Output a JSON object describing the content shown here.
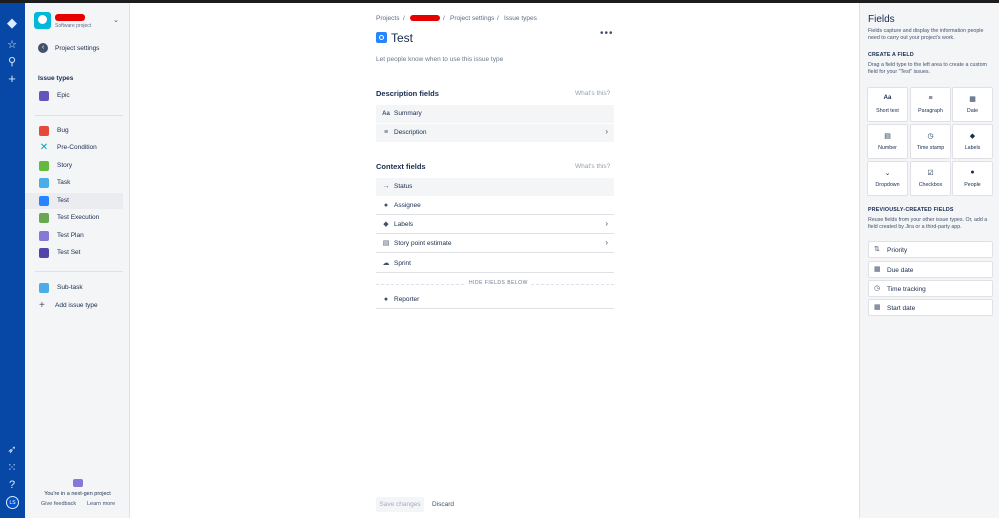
{
  "global_nav": {
    "avatar_initials": "LS"
  },
  "project": {
    "type": "Software project"
  },
  "sidebar": {
    "back_label": "Project settings",
    "section_title": "Issue types",
    "items": [
      {
        "label": "Epic",
        "color": "#6554C0"
      },
      {
        "label": "Bug",
        "color": "#E5493A"
      },
      {
        "label": "Pre-Condition",
        "color": "#00A3BF"
      },
      {
        "label": "Story",
        "color": "#63BA3C"
      },
      {
        "label": "Task",
        "color": "#4BADE8"
      },
      {
        "label": "Test",
        "color": "#2684FF"
      },
      {
        "label": "Test Execution",
        "color": "#6AA84F"
      },
      {
        "label": "Test Plan",
        "color": "#8777D9"
      },
      {
        "label": "Test Set",
        "color": "#5243AA"
      },
      {
        "label": "Sub-task",
        "color": "#4BADE8"
      }
    ],
    "add_label": "Add issue type",
    "next_gen_text": "You're in a next-gen project",
    "give_feedback": "Give feedback",
    "learn_more": "Learn more"
  },
  "main": {
    "breadcrumb": {
      "projects": "Projects",
      "project_settings": "Project settings",
      "issue_types": "Issue types",
      "sep": "/"
    },
    "title": "Test",
    "more": "•••",
    "description_placeholder": "Let people know when to use this issue type",
    "description_fields_title": "Description fields",
    "whats_this": "What's this?",
    "description_fields": [
      {
        "label": "Summary",
        "icon": "Aa"
      },
      {
        "label": "Description",
        "icon": "≡"
      }
    ],
    "context_fields_title": "Context fields",
    "context_fields": [
      {
        "label": "Status",
        "icon": "→"
      },
      {
        "label": "Assignee",
        "icon": "●"
      },
      {
        "label": "Labels",
        "icon": "◆"
      },
      {
        "label": "Story point estimate",
        "icon": "▤"
      },
      {
        "label": "Sprint",
        "icon": "☁"
      }
    ],
    "hide_fields_label": "HIDE FIELDS BELOW",
    "hidden_fields": [
      {
        "label": "Reporter",
        "icon": "●"
      }
    ],
    "chevron": "›",
    "save_label": "Save changes",
    "discard_label": "Discard"
  },
  "panel": {
    "title": "Fields",
    "intro": "Fields capture and display the information people need to carry out your project's work.",
    "create_title": "CREATE A FIELD",
    "create_text": "Drag a field type to the left area to create a custom field for your \"Test\" issues.",
    "field_types": [
      {
        "label": "Short text",
        "icon": "Aa"
      },
      {
        "label": "Paragraph",
        "icon": "≡"
      },
      {
        "label": "Date",
        "icon": "▦"
      },
      {
        "label": "Number",
        "icon": "▤"
      },
      {
        "label": "Time stamp",
        "icon": "◷"
      },
      {
        "label": "Labels",
        "icon": "◆"
      },
      {
        "label": "Dropdown",
        "icon": "⌄"
      },
      {
        "label": "Checkbox",
        "icon": "☑"
      },
      {
        "label": "People",
        "icon": "●"
      }
    ],
    "previous_title": "PREVIOUSLY-CREATED FIELDS",
    "previous_text": "Reuse fields from your other issue types. Or, add a field created by Jira or a third-party app.",
    "previous_fields": [
      {
        "label": "Priority",
        "icon": "⇅"
      },
      {
        "label": "Due date",
        "icon": "▦"
      },
      {
        "label": "Time tracking",
        "icon": "◷"
      },
      {
        "label": "Start date",
        "icon": "▦"
      }
    ]
  }
}
